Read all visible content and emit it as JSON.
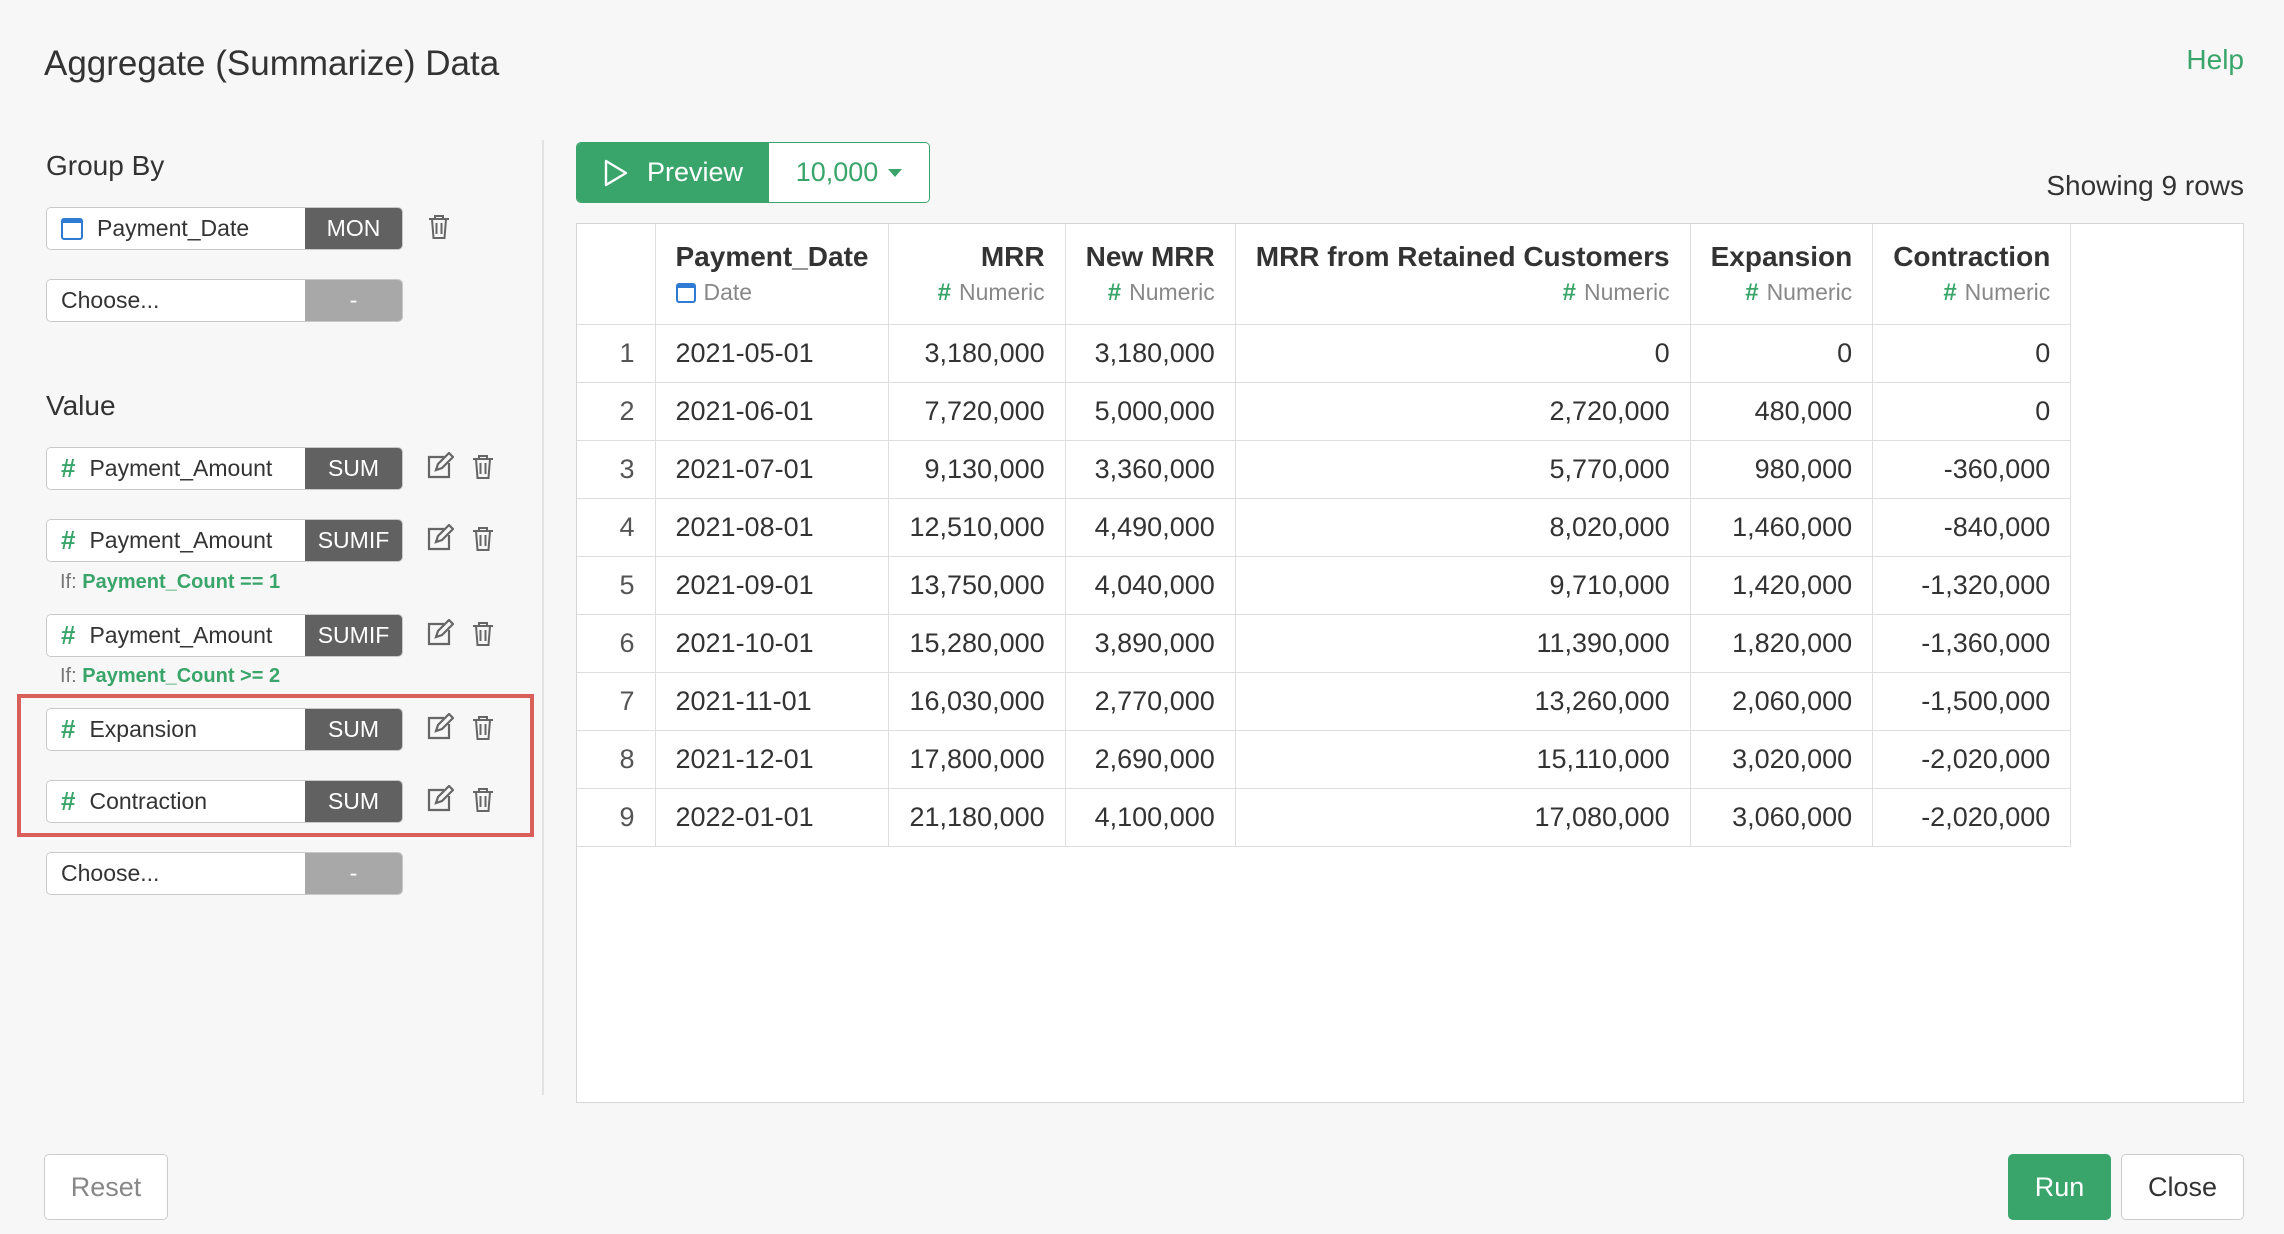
{
  "header": {
    "title": "Aggregate (Summarize) Data",
    "help": "Help"
  },
  "group_by": {
    "label": "Group By",
    "items": [
      {
        "icon": "calendar-icon",
        "name": "Payment_Date",
        "agg": "MON"
      },
      {
        "placeholder": "Choose...",
        "agg": "-"
      }
    ]
  },
  "value": {
    "label": "Value",
    "items": [
      {
        "icon": "hash-icon",
        "name": "Payment_Amount",
        "agg": "SUM"
      },
      {
        "icon": "hash-icon",
        "name": "Payment_Amount",
        "agg": "SUMIF",
        "if_label": "If:",
        "condition": "Payment_Count == 1"
      },
      {
        "icon": "hash-icon",
        "name": "Payment_Amount",
        "agg": "SUMIF",
        "if_label": "If:",
        "condition": "Payment_Count >= 2"
      },
      {
        "icon": "hash-icon",
        "name": "Expansion",
        "agg": "SUM"
      },
      {
        "icon": "hash-icon",
        "name": "Contraction",
        "agg": "SUM"
      },
      {
        "placeholder": "Choose...",
        "agg": "-"
      }
    ]
  },
  "toolbar": {
    "preview": "Preview",
    "limit": "10,000",
    "showing": "Showing 9 rows"
  },
  "table": {
    "columns": [
      {
        "name": "Payment_Date",
        "type": "Date"
      },
      {
        "name": "MRR",
        "type": "Numeric"
      },
      {
        "name": "New MRR",
        "type": "Numeric"
      },
      {
        "name": "MRR from Retained Customers",
        "type": "Numeric"
      },
      {
        "name": "Expansion",
        "type": "Numeric"
      },
      {
        "name": "Contraction",
        "type": "Numeric"
      }
    ],
    "rows": [
      [
        "1",
        "2021-05-01",
        "3,180,000",
        "3,180,000",
        "0",
        "0",
        "0"
      ],
      [
        "2",
        "2021-06-01",
        "7,720,000",
        "5,000,000",
        "2,720,000",
        "480,000",
        "0"
      ],
      [
        "3",
        "2021-07-01",
        "9,130,000",
        "3,360,000",
        "5,770,000",
        "980,000",
        "-360,000"
      ],
      [
        "4",
        "2021-08-01",
        "12,510,000",
        "4,490,000",
        "8,020,000",
        "1,460,000",
        "-840,000"
      ],
      [
        "5",
        "2021-09-01",
        "13,750,000",
        "4,040,000",
        "9,710,000",
        "1,420,000",
        "-1,320,000"
      ],
      [
        "6",
        "2021-10-01",
        "15,280,000",
        "3,890,000",
        "11,390,000",
        "1,820,000",
        "-1,360,000"
      ],
      [
        "7",
        "2021-11-01",
        "16,030,000",
        "2,770,000",
        "13,260,000",
        "2,060,000",
        "-1,500,000"
      ],
      [
        "8",
        "2021-12-01",
        "17,800,000",
        "2,690,000",
        "15,110,000",
        "3,020,000",
        "-2,020,000"
      ],
      [
        "9",
        "2022-01-01",
        "21,180,000",
        "4,100,000",
        "17,080,000",
        "3,060,000",
        "-2,020,000"
      ]
    ]
  },
  "footer": {
    "reset": "Reset",
    "run": "Run",
    "close": "Close"
  },
  "colors": {
    "accent": "#3aa56a",
    "highlight": "#d9605a",
    "agg_bg": "#616161"
  }
}
